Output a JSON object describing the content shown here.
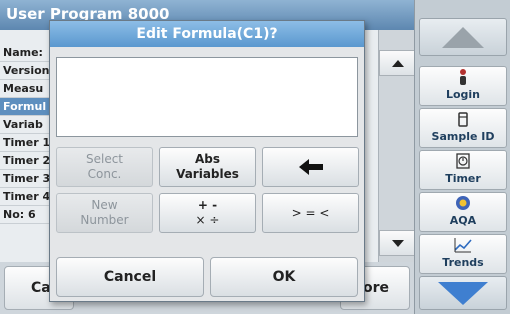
{
  "background": {
    "title": "User Program 8000",
    "rows": [
      "Name:",
      "Version",
      "Measu",
      "Formul",
      "Variab",
      "Timer 1",
      "Timer 2",
      "Timer 3",
      "Timer 4",
      "No: 6"
    ],
    "selected_row": "Formul",
    "bottom_left_label": "Ca",
    "bottom_right_label": "ore"
  },
  "sidebar": {
    "items": [
      {
        "label": "Login",
        "icon": "person-icon"
      },
      {
        "label": "Sample ID",
        "icon": "sample-icon"
      },
      {
        "label": "Timer",
        "icon": "timer-icon"
      },
      {
        "label": "AQA",
        "icon": "aqa-icon"
      },
      {
        "label": "Trends",
        "icon": "trends-icon"
      }
    ]
  },
  "dialog": {
    "title": "Edit Formula(C1)?",
    "formula_value": "",
    "keys": {
      "select_conc_1": "Select",
      "select_conc_2": "Conc.",
      "abs_vars_1": "Abs",
      "abs_vars_2": "Variables",
      "backspace_icon": "arrow-left-icon",
      "new_number_1": "New",
      "new_number_2": "Number",
      "operators_1": "+ -",
      "operators_2": "× ÷",
      "compare": "> = <"
    },
    "cancel": "Cancel",
    "ok": "OK"
  },
  "colors": {
    "title_bar": "#5a98cf",
    "selected_row": "#5d8fbf",
    "nav_arrow": "#3f7fd0"
  }
}
